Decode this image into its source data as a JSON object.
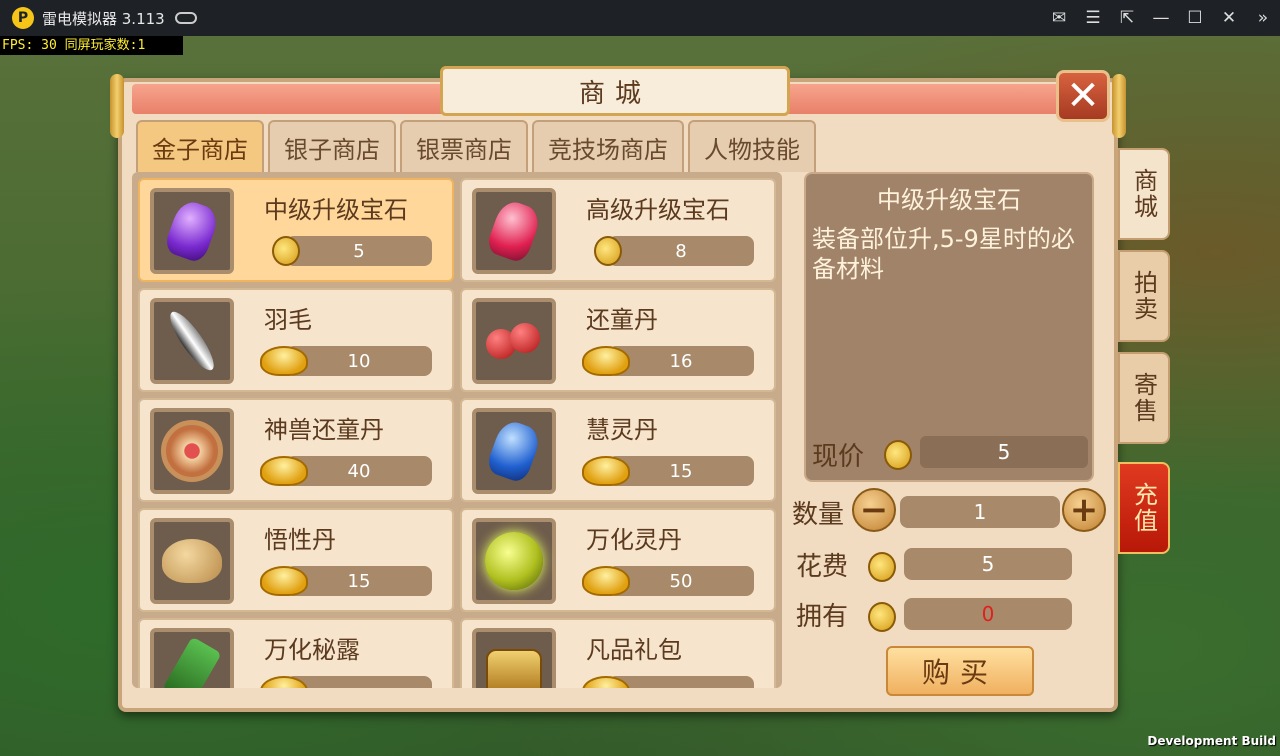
{
  "window": {
    "logo": "P",
    "title": "雷电模拟器 3.113"
  },
  "overlay": {
    "fps": "FPS: 30 同屏玩家数:1",
    "dev_build": "Development Build"
  },
  "panel": {
    "title": "商城",
    "close_label": "✕",
    "tabs": [
      "金子商店",
      "银子商店",
      "银票商店",
      "竞技场商店",
      "人物技能"
    ],
    "active_tab": 0
  },
  "items": [
    {
      "name": "中级升级宝石",
      "price": "5",
      "currency": "coin",
      "icon": "purple-gem-icon",
      "selected": true
    },
    {
      "name": "高级升级宝石",
      "price": "8",
      "currency": "coin",
      "icon": "red-gem-icon"
    },
    {
      "name": "羽毛",
      "price": "10",
      "currency": "ingot",
      "icon": "feather-icon"
    },
    {
      "name": "还童丹",
      "price": "16",
      "currency": "ingot",
      "icon": "red-pills-icon"
    },
    {
      "name": "神兽还童丹",
      "price": "40",
      "currency": "ingot",
      "icon": "amulet-icon"
    },
    {
      "name": "慧灵丹",
      "price": "15",
      "currency": "ingot",
      "icon": "blue-gem-icon"
    },
    {
      "name": "悟性丹",
      "price": "15",
      "currency": "ingot",
      "icon": "pouch-icon"
    },
    {
      "name": "万化灵丹",
      "price": "50",
      "currency": "ingot",
      "icon": "orb-icon"
    },
    {
      "name": "万化秘露",
      "price": "",
      "currency": "ingot",
      "icon": "bottle-icon"
    },
    {
      "name": "凡品礼包",
      "price": "",
      "currency": "ingot",
      "icon": "chest-icon"
    }
  ],
  "detail": {
    "name": "中级升级宝石",
    "description": "装备部位升,5-9星时的必备材料",
    "price_label": "现价",
    "price": "5"
  },
  "purchase": {
    "qty_label": "数量",
    "qty": "1",
    "cost_label": "花费",
    "cost": "5",
    "own_label": "拥有",
    "own": "0",
    "buy_label": "购买"
  },
  "side_tabs": [
    "商城",
    "拍卖",
    "寄售",
    "充值"
  ],
  "colors": {
    "own_value": "#e02020",
    "accent": "#f4c880"
  }
}
